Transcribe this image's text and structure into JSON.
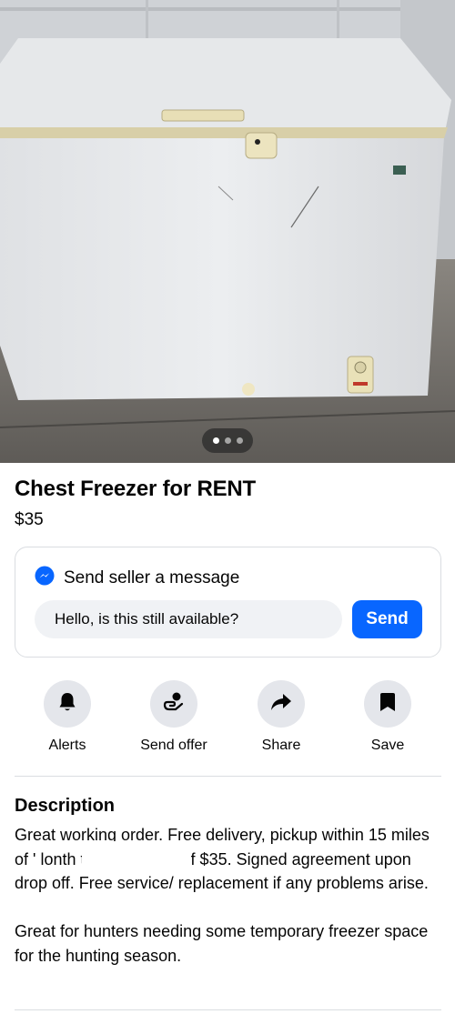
{
  "listing": {
    "title": "Chest Freezer for RENT",
    "price": "$35",
    "photo_pager": {
      "total": 3,
      "active": 1
    }
  },
  "message": {
    "heading": "Send seller a message",
    "input_value": "Hello, is this still available?",
    "send_label": "Send",
    "icon": "messenger-icon"
  },
  "actions": [
    {
      "label": "Alerts",
      "icon": "bell-icon"
    },
    {
      "label": "Send offer",
      "icon": "offer-icon"
    },
    {
      "label": "Share",
      "icon": "share-icon"
    },
    {
      "label": "Save",
      "icon": "bookmark-icon"
    }
  ],
  "description": {
    "heading": "Description",
    "paragraph1": "Great working order.  Free delivery, pickup within 15 miles of '                              lonth to month rent of $35. Signed agreement upon drop off. Free service/ replacement if any problems arise.",
    "paragraph2": "Great for hunters needing some temporary freezer space for the hunting season."
  },
  "colors": {
    "accent": "#0866ff",
    "button_bg": "#e4e6eb",
    "input_bg": "#f0f2f5",
    "text": "#050505"
  }
}
